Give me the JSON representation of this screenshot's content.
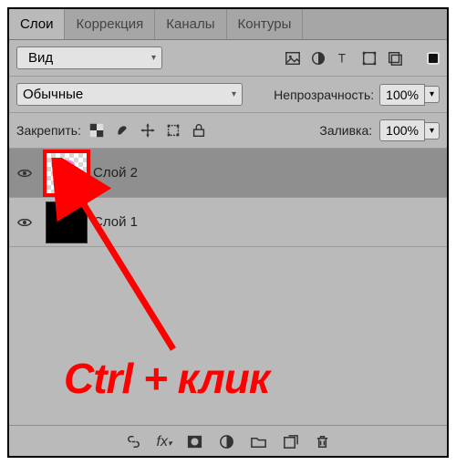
{
  "tabs": {
    "layers": "Слои",
    "correction": "Коррекция",
    "channels": "Каналы",
    "paths": "Контуры"
  },
  "filter": {
    "label": "Вид",
    "search_icon": "search-icon"
  },
  "blend": {
    "mode": "Обычные"
  },
  "opacity": {
    "label": "Непрозрачность:",
    "value": "100%"
  },
  "fill": {
    "label": "Заливка:",
    "value": "100%"
  },
  "lock": {
    "label": "Закрепить:"
  },
  "layers": [
    {
      "name": "Слой 2",
      "visible": true,
      "selected": true,
      "kind": "flower"
    },
    {
      "name": "Слой 1",
      "visible": true,
      "selected": false,
      "kind": "black"
    }
  ],
  "annotation": "Ctrl + клик"
}
